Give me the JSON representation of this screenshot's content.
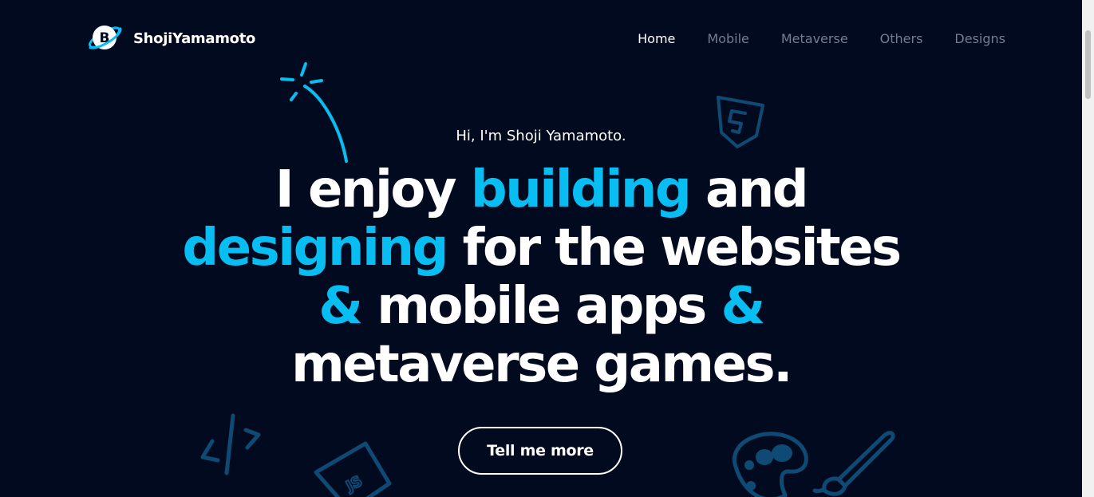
{
  "brand": {
    "name": "ShojiYamamoto",
    "logo_letter": "B"
  },
  "nav": {
    "items": [
      {
        "label": "Home",
        "active": true
      },
      {
        "label": "Mobile",
        "active": false
      },
      {
        "label": "Metaverse",
        "active": false
      },
      {
        "label": "Others",
        "active": false
      },
      {
        "label": "Designs",
        "active": false
      }
    ]
  },
  "hero": {
    "greeting": "Hi, I'm Shoji Yamamoto.",
    "headline": {
      "line1_a": "I enjoy ",
      "line1_b": "building",
      "line1_c": " and",
      "line2_a": "designing",
      "line2_b": " for the websites",
      "line3_a": "&",
      "line3_b": " mobile apps ",
      "line3_c": "&",
      "line4": "metaverse games."
    },
    "cta_label": "Tell me more"
  },
  "doodles": {
    "js_badge_text": "JS"
  },
  "colors": {
    "background": "#020a1f",
    "accent": "#08bdf1",
    "doodle": "#0f4a74",
    "nav_inactive": "#727d8f"
  },
  "icons": [
    "logo-icon",
    "sparkle-icon",
    "html5-icon",
    "code-icon",
    "js-file-icon",
    "palette-icon",
    "paintbrush-icon"
  ]
}
